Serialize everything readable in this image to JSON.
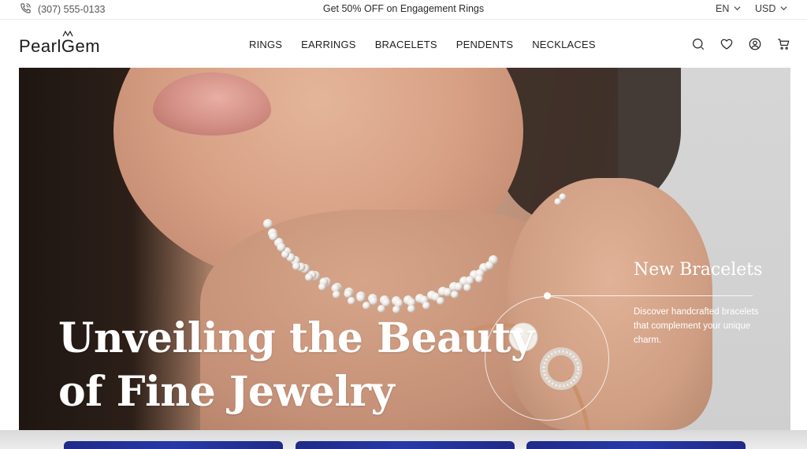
{
  "topbar": {
    "phone": "(307) 555-0133",
    "promo": "Get 50% OFF on Engagement Rings",
    "language": "EN",
    "currency": "USD"
  },
  "header": {
    "logo": "PearlGem",
    "nav": [
      "RINGS",
      "EARRINGS",
      "BRACELETS",
      "PENDENTS",
      "NECKLACES"
    ],
    "icons": [
      "search-icon",
      "heart-icon",
      "user-icon",
      "cart-icon"
    ]
  },
  "hero": {
    "title_line1": "Unveiling the Beauty",
    "title_line2": "of Fine Jewelry",
    "callout_title": "New Bracelets",
    "callout_text": "Discover handcrafted bracelets that complement your unique charm."
  },
  "colors": {
    "text": "#1f1f1f",
    "card_blue": "#2639a7",
    "white": "#ffffff"
  }
}
